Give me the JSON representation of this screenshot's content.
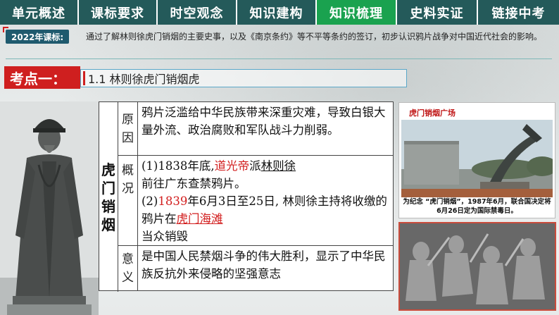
{
  "tabs": [
    {
      "label": "单元概述",
      "active": false
    },
    {
      "label": "课标要求",
      "active": false
    },
    {
      "label": "时空观念",
      "active": false
    },
    {
      "label": "知识建构",
      "active": false
    },
    {
      "label": "知识梳理",
      "active": true
    },
    {
      "label": "史料实证",
      "active": false
    },
    {
      "label": "链接中考",
      "active": false
    }
  ],
  "standard": {
    "label": "2022年课标:",
    "text": "通过了解林则徐虎门销烟的主要史事，以及《南京条约》等不平等条约的签订，初步认识鸦片战争对中国近代社会的影响。"
  },
  "topic": {
    "label": "考点一：",
    "title": "1.1  林则徐虎门销烟虎"
  },
  "table": {
    "title_chars": [
      "虎",
      "门",
      "销",
      "烟"
    ],
    "rows": [
      {
        "head_chars": [
          "原",
          "因"
        ],
        "text": "鸦片泛滥给中华民族带来深重灾难，导致白银大量外流、政治腐败和军队战斗力削弱。"
      },
      {
        "head_chars": [
          "概",
          "况"
        ],
        "p1_a": "(1)1838年底,",
        "p1_emperor": "道光帝",
        "p1_b": "派",
        "p1_person": "林则徐",
        "p1_c": "前往广东查禁鸦片。",
        "p2_a": "(2)",
        "p2_year": "1839",
        "p2_b": "年6月3日至25日, 林则徐主持将收缴的鸦片在",
        "p2_place": "虎门海滩",
        "p2_c": "当众销毁"
      },
      {
        "head_chars": [
          "意",
          "义"
        ],
        "text": "是中国人民禁烟斗争的伟大胜利，显示了中华民族反抗外来侵略的坚强意志"
      }
    ]
  },
  "photo1": {
    "title": "虎门销烟广场",
    "caption": "为纪念 “虎门销烟”，1987年6月，联合国决定将6月26日定为国际禁毒日。"
  },
  "colors": {
    "tab_bg": "#245a5a",
    "tab_active": "#1aa24f",
    "topic_red": "#cf1f1f",
    "highlight_red": "#d21e1e"
  }
}
